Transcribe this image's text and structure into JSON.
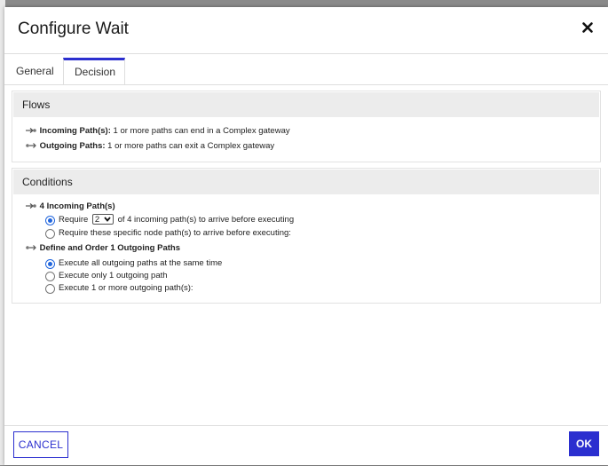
{
  "dialog": {
    "title": "Configure Wait",
    "close_icon": "close-icon"
  },
  "tabs": [
    {
      "label": "General",
      "active": false
    },
    {
      "label": "Decision",
      "active": true
    }
  ],
  "flows": {
    "header": "Flows",
    "incoming": {
      "label": "Incoming Path(s):",
      "text": "1 or more paths can end in a Complex gateway",
      "icon": "incoming-arrow-icon"
    },
    "outgoing": {
      "label": "Outgoing Paths:",
      "text": "1 or more paths can exit a Complex gateway",
      "icon": "outgoing-arrow-icon"
    }
  },
  "conditions": {
    "header": "Conditions",
    "incoming_title": "4 Incoming Path(s)",
    "require_prefix": "Require",
    "require_select_value": "2",
    "require_suffix": "of 4 incoming path(s) to arrive before executing",
    "require_specific": "Require these specific node path(s) to arrive before executing:",
    "outgoing_title": "Define and Order 1 Outgoing Paths",
    "outgoing_options": [
      {
        "label": "Execute all outgoing paths at the same time",
        "checked": true
      },
      {
        "label": "Execute only 1 outgoing path",
        "checked": false
      },
      {
        "label": "Execute 1 or more outgoing path(s):",
        "checked": false
      }
    ],
    "incoming_selected": "require-count"
  },
  "footer": {
    "cancel_label": "CANCEL",
    "ok_label": "OK"
  },
  "colors": {
    "accent": "#2b2fcf",
    "radio_selected": "#2266dd"
  }
}
